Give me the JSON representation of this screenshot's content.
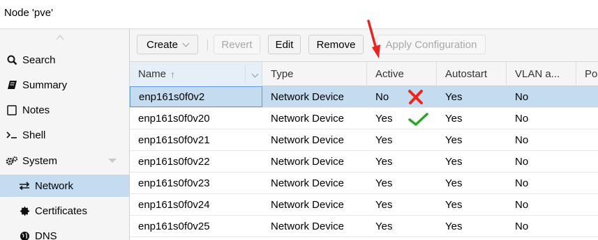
{
  "header": {
    "title": "Node 'pve'"
  },
  "sidebar": {
    "items": [
      {
        "label": "Search",
        "icon": "search-icon"
      },
      {
        "label": "Summary",
        "icon": "book-icon"
      },
      {
        "label": "Notes",
        "icon": "notes-icon"
      },
      {
        "label": "Shell",
        "icon": "terminal-icon"
      },
      {
        "label": "System",
        "icon": "gears-icon"
      },
      {
        "label": "Network",
        "icon": "exchange-icon",
        "selected": true
      },
      {
        "label": "Certificates",
        "icon": "certificate-icon"
      },
      {
        "label": "DNS",
        "icon": "globe-icon"
      }
    ]
  },
  "toolbar": {
    "create": "Create",
    "revert": "Revert",
    "edit": "Edit",
    "remove": "Remove",
    "apply": "Apply Configuration"
  },
  "grid": {
    "columns": [
      "Name",
      "Type",
      "Active",
      "Autostart",
      "VLAN a...",
      "Po"
    ],
    "sort_arrow": "↑",
    "rows": [
      {
        "name": "enp161s0f0v2",
        "type": "Network Device",
        "active": "No",
        "autostart": "Yes",
        "vlan": "No",
        "selected": true
      },
      {
        "name": "enp161s0f0v20",
        "type": "Network Device",
        "active": "Yes",
        "autostart": "Yes",
        "vlan": "No"
      },
      {
        "name": "enp161s0f0v21",
        "type": "Network Device",
        "active": "Yes",
        "autostart": "Yes",
        "vlan": "No"
      },
      {
        "name": "enp161s0f0v22",
        "type": "Network Device",
        "active": "Yes",
        "autostart": "Yes",
        "vlan": "No"
      },
      {
        "name": "enp161s0f0v23",
        "type": "Network Device",
        "active": "Yes",
        "autostart": "Yes",
        "vlan": "No"
      },
      {
        "name": "enp161s0f0v24",
        "type": "Network Device",
        "active": "Yes",
        "autostart": "Yes",
        "vlan": "No"
      },
      {
        "name": "enp161s0f0v25",
        "type": "Network Device",
        "active": "Yes",
        "autostart": "Yes",
        "vlan": "No"
      }
    ]
  },
  "annotations": {
    "arrow_color": "#e8261f",
    "cross_color": "#e8261f",
    "check_color": "#2aa52a"
  },
  "colors": {
    "selected": "#c5dbf0",
    "panel": "#f5f5f5"
  }
}
